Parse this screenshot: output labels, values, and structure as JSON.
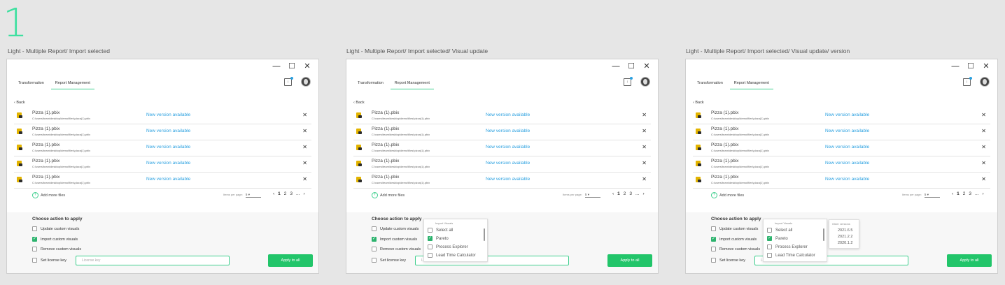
{
  "page_number": "1",
  "frames": [
    {
      "label": "Light - Multiple Report/ Import selected"
    },
    {
      "label": "Light - Multiple Report/ Import selected/ Visual update"
    },
    {
      "label": "Light - Multiple Report/ Import selected/ Visual update/ version"
    }
  ],
  "window": {
    "controls": {
      "minimize": "—",
      "maximize": "☐",
      "close": "✕"
    },
    "tabs": [
      "Transformation",
      "Report Management"
    ],
    "active_tab": "Report Management",
    "back_label": "Back"
  },
  "files": [
    {
      "name": "Pizza (1).pbix",
      "path": "C:\\users\\team\\desktop\\demo\\files\\pizza(1).pbix",
      "status": "New version available"
    },
    {
      "name": "Pizza (1).pbix",
      "path": "C:\\users\\team\\desktop\\demo\\files\\pizza(1).pbix",
      "status": "New version available"
    },
    {
      "name": "Pizza (1).pbix",
      "path": "C:\\users\\team\\desktop\\demo\\files\\pizza(1).pbix",
      "status": "New version available"
    },
    {
      "name": "Pizza (1).pbix",
      "path": "C:\\users\\team\\desktop\\demo\\files\\pizza(1).pbix",
      "status": "New version available"
    },
    {
      "name": "Pizza (1).pbix",
      "path": "C:\\users\\team\\desktop\\demo\\files\\pizza(1).pbix",
      "status": "New version available"
    }
  ],
  "add_more": "Add more files",
  "items_per_page": {
    "label": "Items per page:",
    "value": "5"
  },
  "pager": {
    "prev": "‹",
    "pages": [
      "1",
      "2",
      "3",
      "..."
    ],
    "current": "1",
    "next": "›"
  },
  "actions": {
    "title": "Choose action to apply",
    "options": [
      {
        "label": "Update custom visuals",
        "checked": false
      },
      {
        "label": "Import custom visuals",
        "checked": true
      },
      {
        "label": "Remove custom visuals",
        "checked": false
      },
      {
        "label": "Set license key",
        "checked": false
      }
    ],
    "license_placeholder": "License key",
    "apply_label": "Apply to all"
  },
  "import_dropdown": {
    "title": "Import Visuals",
    "items": [
      {
        "label": "Select all",
        "checked": false
      },
      {
        "label": "Pareto",
        "checked": true
      },
      {
        "label": "Process Explorer",
        "checked": false
      },
      {
        "label": "Lead Time Calculator",
        "checked": false
      }
    ]
  },
  "versions_popup": {
    "title": "Older versions",
    "items": [
      "2021.6.5",
      "2021.2.2",
      "2020.1.2"
    ]
  },
  "colors": {
    "accent": "#3ecf8e",
    "button": "#22c56a",
    "link": "#2aa0e0"
  }
}
